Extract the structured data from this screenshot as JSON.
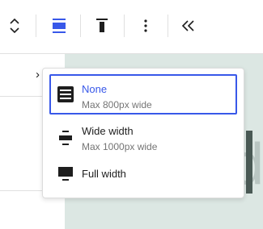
{
  "toolbar": {
    "buttons": [
      {
        "name": "move-up-down",
        "icon": "chevron-up-down-icon"
      },
      {
        "name": "align",
        "icon": "align-center-icon",
        "active": true
      },
      {
        "name": "vertical-align",
        "icon": "vertical-align-top-icon"
      },
      {
        "name": "more-options",
        "icon": "more-vertical-icon"
      },
      {
        "name": "collapse",
        "icon": "double-chevron-left-icon"
      }
    ],
    "accent": "#3858e9"
  },
  "sidebar": {
    "chevron": "›"
  },
  "canvas": {
    "background": "#dce7e3",
    "letter": "d"
  },
  "width_menu": {
    "options": [
      {
        "label": "None",
        "description": "Max 800px wide",
        "selected": true
      },
      {
        "label": "Wide width",
        "description": "Max 1000px wide",
        "selected": false
      },
      {
        "label": "Full width",
        "description": "",
        "selected": false
      }
    ]
  }
}
